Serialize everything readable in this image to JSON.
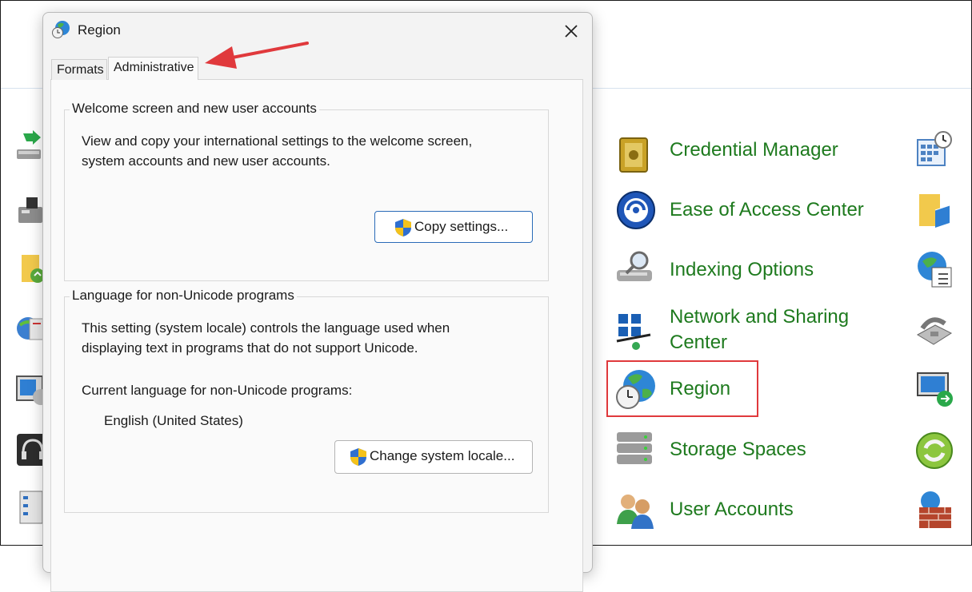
{
  "control_panel": {
    "items": [
      {
        "label": "Credential Manager",
        "icon": "credential-manager-icon"
      },
      {
        "label": "Ease of Access Center",
        "icon": "ease-of-access-icon"
      },
      {
        "label": "Indexing Options",
        "icon": "indexing-options-icon"
      },
      {
        "label": "Network and Sharing",
        "label2": "Center",
        "icon": "network-sharing-icon"
      },
      {
        "label": "Region",
        "icon": "region-icon"
      },
      {
        "label": "Storage Spaces",
        "icon": "storage-spaces-icon"
      },
      {
        "label": "User Accounts",
        "icon": "user-accounts-icon"
      }
    ],
    "highlight_color": "#e0393c",
    "link_color": "#1e7a1e"
  },
  "dialog": {
    "title": "Region",
    "tabs": [
      {
        "label": "Formats",
        "active": false
      },
      {
        "label": "Administrative",
        "active": true
      }
    ],
    "welcome_group": {
      "title": "Welcome screen and new user accounts",
      "text_line1": "View and copy your international settings to the welcome screen,",
      "text_line2": "system accounts and new user accounts.",
      "button": "Copy settings..."
    },
    "language_group": {
      "title": "Language for non-Unicode programs",
      "text_line1": "This setting (system locale) controls the language used when",
      "text_line2": "displaying text in programs that do not support Unicode.",
      "current_label": "Current language for non-Unicode programs:",
      "current_value": "English (United States)",
      "button": "Change system locale..."
    }
  },
  "annotation": {
    "arrow_color": "#e0393c"
  }
}
